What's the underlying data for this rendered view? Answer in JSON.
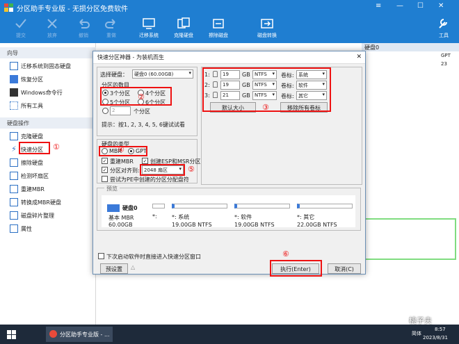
{
  "app": {
    "title": "分区助手专业版 - 无损分区免费软件"
  },
  "toolbar": {
    "items": [
      {
        "label": "提交",
        "icon": "submit-icon"
      },
      {
        "label": "放弃",
        "icon": "discard-icon"
      },
      {
        "label": "撤销",
        "icon": "undo-icon"
      },
      {
        "label": "重做",
        "icon": "redo-icon"
      },
      {
        "label": "迁移系统",
        "icon": "migrate-icon"
      },
      {
        "label": "克隆硬盘",
        "icon": "clone-icon"
      },
      {
        "label": "擦除磁盘",
        "icon": "wipe-icon"
      },
      {
        "label": "磁盘转换",
        "icon": "convert-icon"
      },
      {
        "label": "工具",
        "icon": "tools-icon"
      }
    ]
  },
  "sidebar": {
    "section1": "向导",
    "wizard_items": [
      "迁移系统到固态硬盘",
      "恢复分区",
      "Windows命令行",
      "所有工具"
    ],
    "section2": "硬盘操作",
    "disk_items": [
      "克隆硬盘",
      "快速分区",
      "擦除硬盘",
      "检测坏扇区",
      "重建MBR",
      "转换成MBR硬盘",
      "磁盘碎片整理",
      "属性"
    ]
  },
  "main": {
    "disk_header": "硬盘0",
    "disk_size": "GPT",
    "side_number": "23"
  },
  "dialog": {
    "title": "快速分区神器 - 为装机而生",
    "select_disk_label": "选择硬盘：",
    "select_disk_value": "硬盘0 (60.00GB)",
    "part_count_group": "分区的数目",
    "opt3": "3个分区",
    "opt4": "4个分区",
    "opt5": "5个分区",
    "opt6": "6个分区",
    "custom_count": "2",
    "custom_suffix": "个分区",
    "hint": "提示：按1, 2, 3, 4, 5, 6键试试看",
    "disk_type_group": "硬盘的类型",
    "mbr": "MBR",
    "gpt": "GPT",
    "rebuild_mbr": "重建MBR",
    "create_esp": "创建ESP和MSR分区",
    "align_label": "分区对齐到:",
    "align_value": "2048 扇区",
    "try_pe": "尝试为PE中创建的分区分配盘符",
    "partitions": [
      {
        "num": "1:",
        "size": "19",
        "unit": "GB",
        "fs": "NTFS",
        "label_title": "卷标:",
        "label": "系统"
      },
      {
        "num": "2:",
        "size": "19",
        "unit": "GB",
        "fs": "NTFS",
        "label_title": "卷标:",
        "label": "软件"
      },
      {
        "num": "3:",
        "size": "21",
        "unit": "GB",
        "fs": "NTFS",
        "label_title": "卷标:",
        "label": "其它"
      }
    ],
    "default_size_btn": "默认大小",
    "remove_labels_btn": "移除所有卷标",
    "preview_label": "预览",
    "preview": {
      "disk_name": "硬盘0",
      "disk_basic": "基本 MBR",
      "disk_size": "60.00GB",
      "parts": [
        {
          "name": "*:",
          "size": ""
        },
        {
          "name": "*: 系统",
          "size": "19.00GB NTFS"
        },
        {
          "name": "*: 软件",
          "size": "19.00GB NTFS"
        },
        {
          "name": "*: 其它",
          "size": "22.00GB NTFS"
        }
      ]
    },
    "auto_open": "下次启动软件时直接进入快速分区窗口",
    "preset_btn": "预设置",
    "execute_btn": "执行(Enter)",
    "cancel_btn": "取消(C)"
  },
  "annotations": [
    "①",
    "②",
    "③",
    "④",
    "⑤",
    "⑥"
  ],
  "taskbar": {
    "app_label": "分区助手专业版 - ...",
    "time": "8:57",
    "date": "2023/8/31",
    "ime": "简体",
    "watermark": "桃子夫"
  },
  "colors": {
    "titlebar": "#1f7ed1",
    "highlight": "#e11111",
    "bar_blue": "#3b7ad9"
  }
}
